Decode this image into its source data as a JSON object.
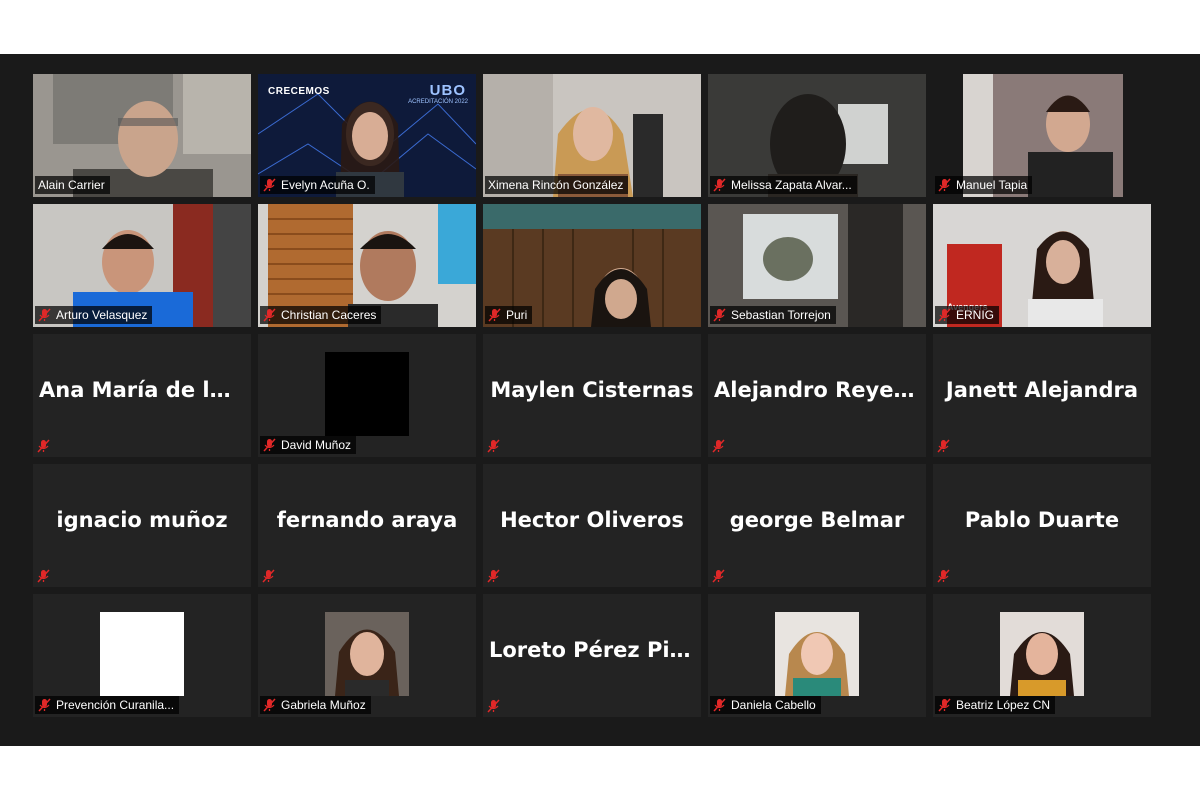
{
  "participants": [
    {
      "name": "Alain Carrier",
      "type": "video",
      "muted": false
    },
    {
      "name": "Evelyn Acuña O.",
      "type": "video",
      "muted": true
    },
    {
      "name": "Ximena Rincón González",
      "type": "video",
      "muted": false,
      "speaker": true
    },
    {
      "name": "Melissa Zapata Alvar...",
      "type": "video",
      "muted": true
    },
    {
      "name": "Manuel Tapia",
      "type": "video",
      "muted": true
    },
    {
      "name": "Arturo Velasquez",
      "type": "video",
      "muted": true
    },
    {
      "name": "Christian Caceres",
      "type": "video",
      "muted": true
    },
    {
      "name": "Puri",
      "type": "video",
      "muted": true
    },
    {
      "name": "Sebastian Torrejon",
      "type": "video",
      "muted": true
    },
    {
      "name": "ERNIG",
      "type": "video",
      "muted": true
    },
    {
      "name": "Ana María de lo...",
      "type": "name",
      "muted": true
    },
    {
      "name": "David Muñoz",
      "type": "avatar",
      "muted": true
    },
    {
      "name": "Maylen Cisternas",
      "type": "name",
      "muted": true
    },
    {
      "name": "Alejandro  Reyes...",
      "type": "name",
      "muted": true
    },
    {
      "name": "Janett Alejandra",
      "type": "name",
      "muted": true
    },
    {
      "name": "ignacio muñoz",
      "type": "name",
      "muted": true
    },
    {
      "name": "fernando araya",
      "type": "name",
      "muted": true
    },
    {
      "name": "Hector Oliveros",
      "type": "name",
      "muted": true
    },
    {
      "name": "george Belmar",
      "type": "name",
      "muted": true
    },
    {
      "name": "Pablo Duarte",
      "type": "name",
      "muted": true
    },
    {
      "name": "Prevención Curanila...",
      "type": "avatar",
      "muted": true
    },
    {
      "name": "Gabriela Muñoz",
      "type": "avatar",
      "muted": true
    },
    {
      "name": "Loreto  Pérez  Piz...",
      "type": "name",
      "muted": true
    },
    {
      "name": "Daniela Cabello",
      "type": "avatar",
      "muted": true
    },
    {
      "name": "Beatriz López CN",
      "type": "avatar",
      "muted": true
    }
  ],
  "overlays": {
    "evelyn_logo": "CRECEMOS",
    "evelyn_brand": "UBO",
    "evelyn_brand_sub": "ACREDITACIÓN 2022",
    "ernig_poster": "Avengers"
  },
  "colors": {
    "meeting_background": "#1a1a1a",
    "tile_background": "#232323",
    "active_speaker": "#c5e84e",
    "muted_icon": "#e02828"
  }
}
